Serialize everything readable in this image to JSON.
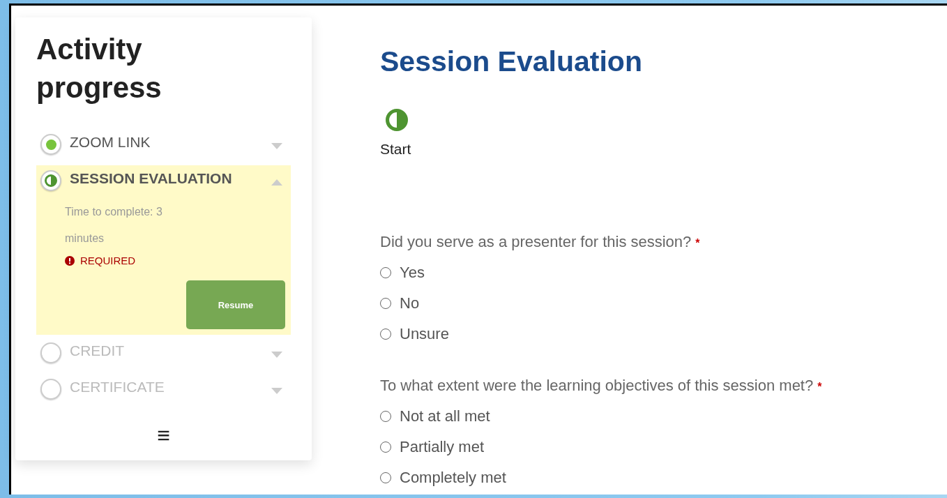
{
  "sidebar": {
    "title": "Activity progress",
    "items": [
      {
        "label": "ZOOM LINK",
        "kind": "complete",
        "expanded": false,
        "selected": false,
        "disabled": false
      },
      {
        "label": "SESSION EVALUATION",
        "kind": "partial",
        "expanded": true,
        "selected": true,
        "disabled": false,
        "details": {
          "time": "Time to complete: 3 minutes",
          "required": "REQUIRED",
          "button": "Resume"
        }
      },
      {
        "label": "CREDIT",
        "kind": "empty",
        "expanded": false,
        "selected": false,
        "disabled": true
      },
      {
        "label": "CERTIFICATE",
        "kind": "empty",
        "expanded": false,
        "selected": false,
        "disabled": true
      }
    ],
    "menu_icon": "≡"
  },
  "main": {
    "title": "Session Evaluation",
    "kind": "partial",
    "status_label": "Start",
    "questions": [
      {
        "text": "Did you serve as a presenter for this session?",
        "required_mark": "*",
        "options": [
          {
            "label": "Yes",
            "selected": false
          },
          {
            "label": "No",
            "selected": false
          },
          {
            "label": "Unsure",
            "selected": false
          }
        ]
      },
      {
        "text": "To what extent were the learning objectives of this session met?",
        "required_mark": "*",
        "options": [
          {
            "label": "Not at all met",
            "selected": false
          },
          {
            "label": "Partially met",
            "selected": false
          },
          {
            "label": "Completely met",
            "selected": false
          }
        ]
      }
    ]
  }
}
